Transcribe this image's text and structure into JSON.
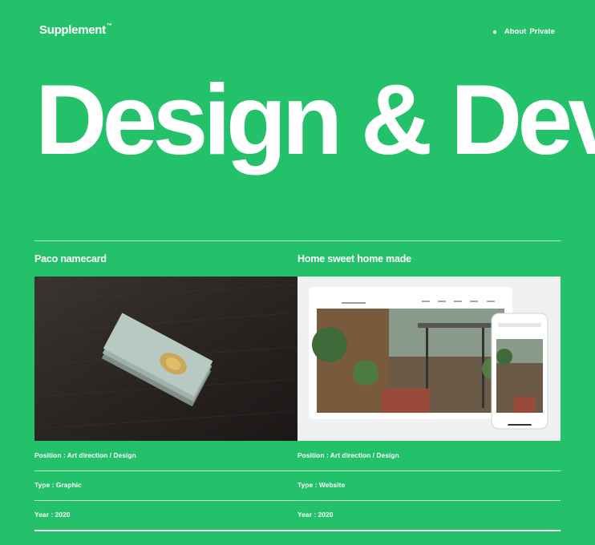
{
  "header": {
    "logo": "Supplement",
    "logo_mark": "™",
    "nav": [
      "About",
      "Private"
    ]
  },
  "hero": {
    "title": "Design & Dev"
  },
  "projects": [
    {
      "title": "Paco namecard",
      "image_alt": "Paco namecard photo",
      "position": "Position : Art direction / Design",
      "type": "Type : Graphic",
      "year": "Year : 2020"
    },
    {
      "title": "Home sweet home made",
      "image_alt": "Home sweet home made website",
      "position": "Position : Art direction / Design",
      "type": "Type : Website",
      "year": "Year : 2020"
    }
  ],
  "colors": {
    "background": "#24c16b",
    "text": "#ffffff"
  }
}
